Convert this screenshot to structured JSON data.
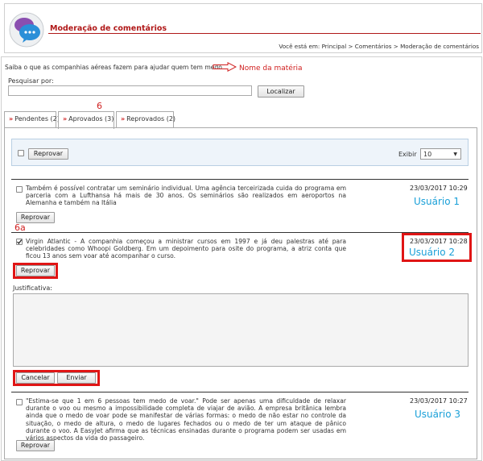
{
  "header": {
    "title": "Moderação de comentários",
    "breadcrumb": "Você está em: Principal > Comentários > Moderação de comentários"
  },
  "article": {
    "title": "Saiba o que as companhias aéreas fazem para ajudar quem tem medo",
    "annotation": "Nome da matéria"
  },
  "search": {
    "label": "Pesquisar por:",
    "value": "",
    "button": "Localizar"
  },
  "annotations": {
    "tab_marker": "6",
    "action_marker": "6a",
    "user1": "Usuário 1",
    "user2": "Usuário 2",
    "user3": "Usuário 3"
  },
  "tabs": [
    {
      "label": "Pendentes (2)",
      "active": false
    },
    {
      "label": "Aprovados (3)",
      "active": true
    },
    {
      "label": "Reprovados (2)",
      "active": false
    }
  ],
  "toolbar": {
    "bulk_button": "Reprovar",
    "show_label": "Exibir",
    "show_value": "10"
  },
  "comments": [
    {
      "text": "Também é possível contratar um seminário individual. Uma agência terceirizada cuida do programa em parceria com a Lufthansa há mais de 30 anos. Os seminários são realizados em aeroportos na Alemanha e também na Itália",
      "date": "23/03/2017 10:29",
      "checked": false,
      "button": "Reprovar"
    },
    {
      "text": "Virgin Atlantic - A companhia começou a ministrar cursos em 1997 e já deu palestras até para celebridades como Whoopi Goldberg. Em um depoimento para osite do programa, a atriz conta que ficou 13 anos sem voar até acompanhar o curso.",
      "date": "23/03/2017 10:28",
      "checked": true,
      "button": "Reprovar"
    },
    {
      "text": "\"Estima-se que 1 em 6 pessoas tem medo de voar.\" Pode ser apenas uma dificuldade de relaxar durante o voo ou mesmo a impossibilidade completa de viajar de avião. A empresa britânica lembra ainda que o medo de voar pode se manifestar de várias formas: o medo de não estar no controle da situação, o medo de altura, o medo de lugares fechados ou o medo de ter um ataque de pânico durante o voo. A EasyJet afirma que as técnicas ensinadas durante o programa podem ser usadas em vários aspectos da vida do passageiro.",
      "date": "23/03/2017 10:27",
      "checked": false,
      "button": "Reprovar"
    }
  ],
  "justification": {
    "label": "Justificativa:",
    "value": "",
    "cancel": "Cancelar",
    "send": "Enviar"
  }
}
